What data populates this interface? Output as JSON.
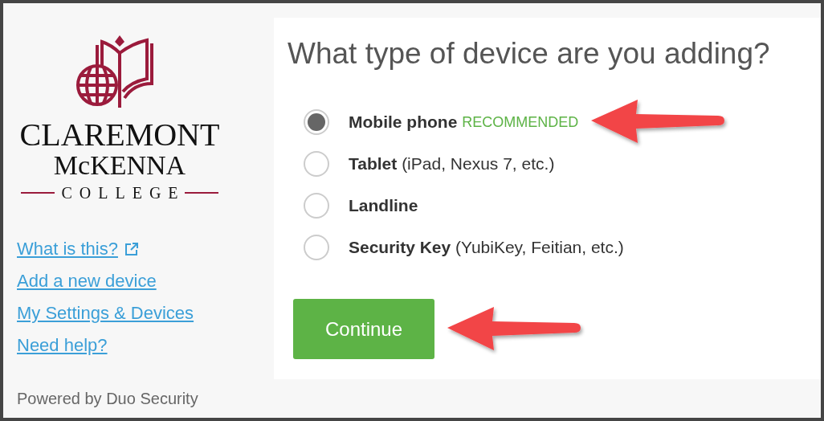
{
  "logo": {
    "lines": [
      "CLAREMONT",
      "McKENNA",
      "COLLEGE"
    ]
  },
  "links": [
    {
      "label": "What is this?",
      "external": true
    },
    {
      "label": "Add a new device"
    },
    {
      "label": "My Settings & Devices"
    },
    {
      "label": "Need help?"
    }
  ],
  "footer": "Powered by Duo Security",
  "prompt": {
    "title": "What type of device are you adding?",
    "options": [
      {
        "label": "Mobile phone",
        "badge": "RECOMMENDED",
        "selected": true,
        "arrow": true
      },
      {
        "label": "Tablet",
        "detail": "(iPad, Nexus 7, etc.)",
        "selected": false
      },
      {
        "label": "Landline",
        "selected": false
      },
      {
        "label": "Security Key",
        "detail": "(YubiKey, Feitian, etc.)",
        "selected": false
      }
    ],
    "button": {
      "label": "Continue",
      "arrow": true
    }
  }
}
